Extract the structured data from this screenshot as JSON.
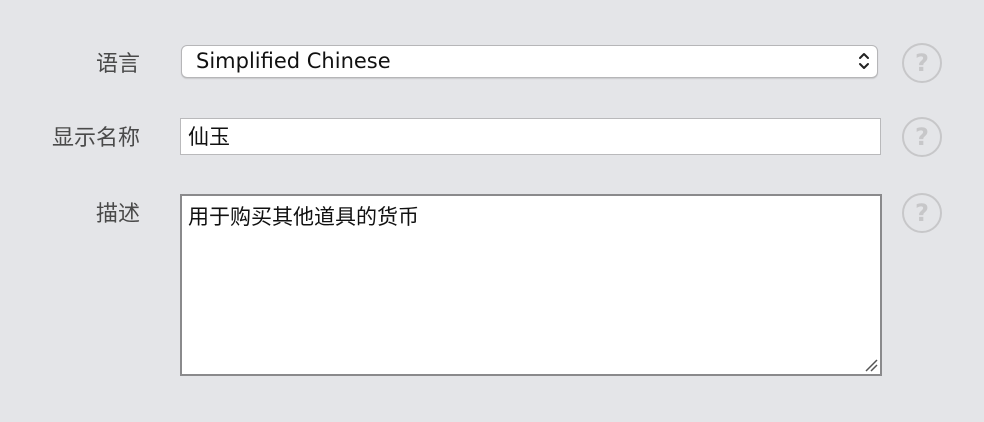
{
  "form": {
    "language": {
      "label": "语言",
      "selected_value": "Simplified Chinese"
    },
    "display_name": {
      "label": "显示名称",
      "value": "仙玉"
    },
    "description": {
      "label": "描述",
      "value": "用于购买其他道具的货币"
    },
    "help_glyph": "?"
  },
  "icons": {
    "help": "question-circle-icon",
    "select_arrows": "chevron-up-down-icon",
    "resize": "resize-grip-icon"
  }
}
